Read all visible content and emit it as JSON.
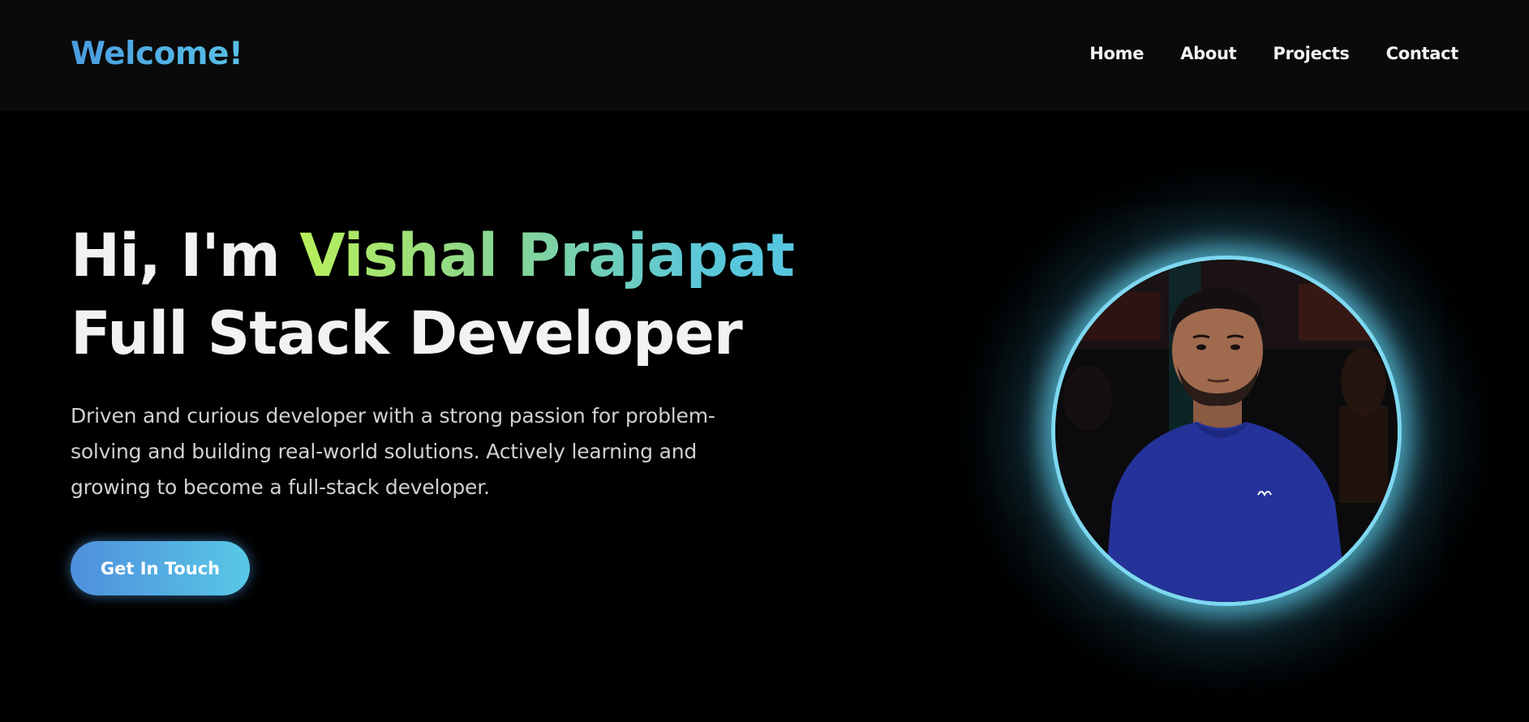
{
  "header": {
    "brand": "Welcome!",
    "nav": [
      "Home",
      "About",
      "Projects",
      "Contact"
    ]
  },
  "hero": {
    "greeting": "Hi, I'm",
    "name": "Vishal Prajapat",
    "role": "Full Stack Developer",
    "description": "Driven and curious developer with a strong passion for problem-solving and building real-world solutions. Actively learning and growing to become a full-stack developer.",
    "cta_label": "Get In Touch"
  },
  "colors": {
    "background": "#000000",
    "navbar": "#0a0a0a",
    "accent_blue": "#4a9de0",
    "accent_green": "#b8f05a",
    "accent_cyan": "#58c8e6",
    "ring_glow": "#7ed8f0"
  },
  "icons": {
    "profile": "profile-photo"
  }
}
